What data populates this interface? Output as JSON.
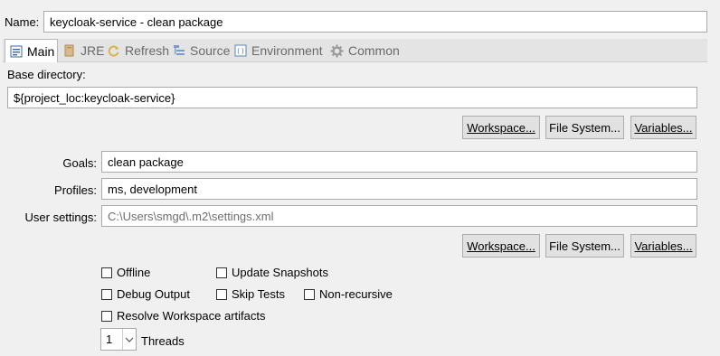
{
  "name": {
    "label": "Name:",
    "value": "keycloak-service - clean package"
  },
  "tabs": [
    {
      "label": "Main",
      "icon": "main-icon"
    },
    {
      "label": "JRE",
      "icon": "jre-icon"
    },
    {
      "label": "Refresh",
      "icon": "refresh-icon"
    },
    {
      "label": "Source",
      "icon": "source-icon"
    },
    {
      "label": "Environment",
      "icon": "environment-icon"
    },
    {
      "label": "Common",
      "icon": "common-icon"
    }
  ],
  "base_directory": {
    "label": "Base directory:",
    "value": "${project_loc:keycloak-service}"
  },
  "buttons": {
    "workspace": "Workspace...",
    "file_system": "File System...",
    "variables": "Variables..."
  },
  "goals": {
    "label": "Goals:",
    "value": "clean package"
  },
  "profiles": {
    "label": "Profiles:",
    "value": "ms, development"
  },
  "user_settings": {
    "label": "User settings:",
    "value": "C:\\Users\\smgd\\.m2\\settings.xml"
  },
  "options": {
    "offline": "Offline",
    "update_snapshots": "Update Snapshots",
    "debug_output": "Debug Output",
    "skip_tests": "Skip Tests",
    "non_recursive": "Non-recursive",
    "resolve_workspace": "Resolve Workspace artifacts"
  },
  "threads": {
    "value": "1",
    "label": "Threads"
  }
}
